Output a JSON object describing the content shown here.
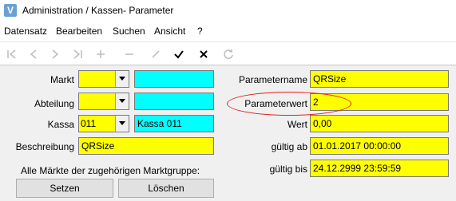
{
  "window": {
    "icon_letter": "V",
    "title": "Administration / Kassen- Parameter"
  },
  "menu": [
    "Datensatz",
    "Bearbeiten",
    "Suchen",
    "Ansicht",
    "?"
  ],
  "toolbar": {
    "icons": [
      "first-record-icon",
      "prev-record-icon",
      "next-record-icon",
      "last-record-icon",
      "insert-record-icon",
      "delete-record-icon",
      "edit-record-icon",
      "post-record-icon",
      "cancel-record-icon",
      "refresh-icon"
    ]
  },
  "form": {
    "markt_label": "Markt",
    "markt_value": "",
    "markt_name": "",
    "abteilung_label": "Abteilung",
    "abteilung_value": "",
    "abteilung_name": "",
    "kassa_label": "Kassa",
    "kassa_value": "011",
    "kassa_name": "Kassa 011",
    "beschreibung_label": "Beschreibung",
    "beschreibung_value": "QRSize",
    "group_note": "Alle Märkte der zugehörigen Marktgruppe:",
    "setzen_label": "Setzen",
    "loeschen_label": "Löschen",
    "parametername_label": "Parametername",
    "parametername_value": "QRSize",
    "parameterwert_label": "Parameterwert",
    "parameterwert_value": "2",
    "wert_label": "Wert",
    "wert_value": "0,00",
    "gueltig_ab_label": "gültig ab",
    "gueltig_ab_value": "01.01.2017 00:00:00",
    "gueltig_bis_label": "gültig bis",
    "gueltig_bis_value": "24.12.2999 23:59:59"
  },
  "colors": {
    "field_yellow": "#ffff00",
    "field_cyan": "#00ffff",
    "highlight_ellipse": "#e02020"
  }
}
